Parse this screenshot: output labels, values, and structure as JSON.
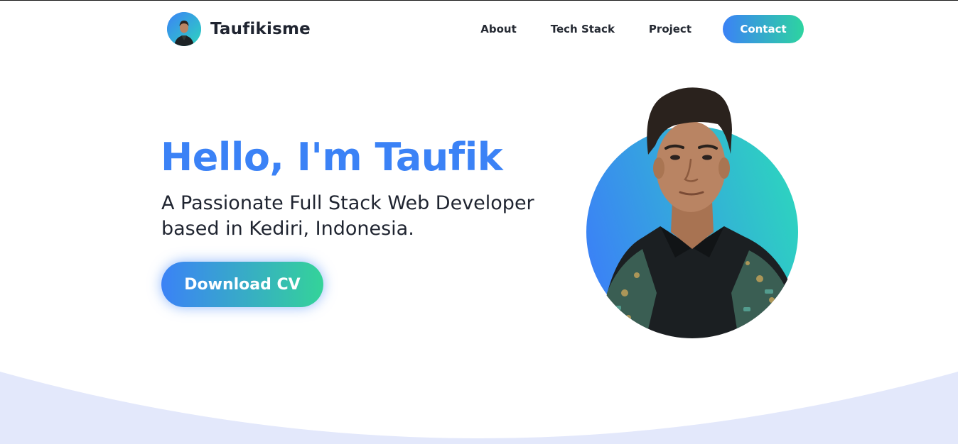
{
  "brand": {
    "name": "Taufikisme",
    "avatar_icon": "profile-photo"
  },
  "nav": {
    "items": [
      {
        "label": "About"
      },
      {
        "label": "Tech Stack"
      },
      {
        "label": "Project"
      }
    ],
    "contact_label": "Contact"
  },
  "hero": {
    "greeting": "Hello, I'm Taufik",
    "subtitle": "A Passionate Full Stack Web Developer based in Kediri, Indonesia.",
    "cta_label": "Download CV",
    "portrait_icon": "profile-portrait"
  },
  "colors": {
    "accent_blue": "#3b82f6",
    "accent_green": "#2dd4a0",
    "text_dark": "#1f2430",
    "wave": "#e3e8fb"
  }
}
